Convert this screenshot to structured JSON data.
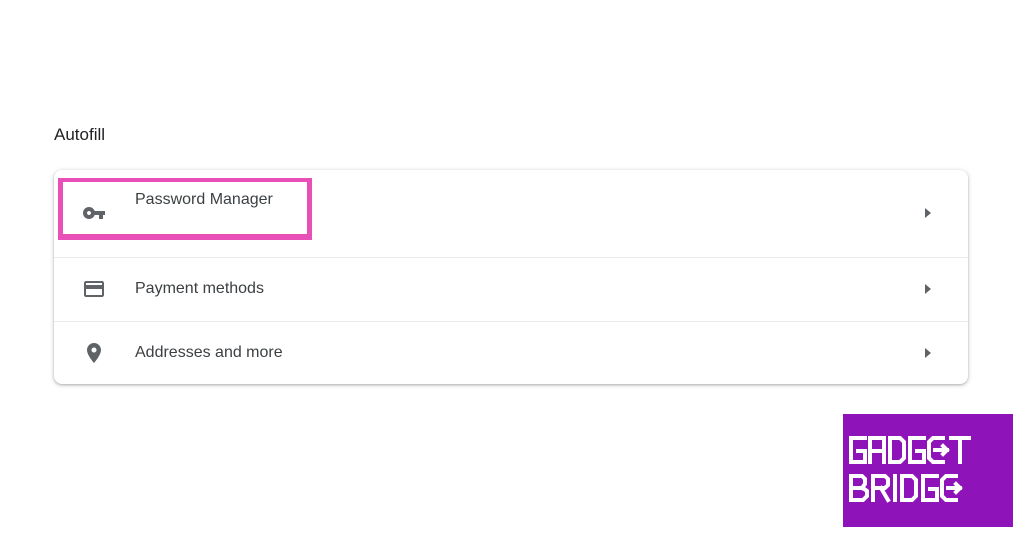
{
  "section": {
    "title": "Autofill"
  },
  "autofill": {
    "items": [
      {
        "label": "Password Manager",
        "icon": "key-icon"
      },
      {
        "label": "Payment methods",
        "icon": "credit-card-icon"
      },
      {
        "label": "Addresses and more",
        "icon": "location-pin-icon"
      }
    ]
  },
  "colors": {
    "highlight": "#e84fb7",
    "logo_background": "#8e13b8",
    "icon": "#5f6368",
    "text": "#3c4043"
  },
  "watermark": {
    "line1": "GADGET",
    "line2": "BRIDGE"
  }
}
